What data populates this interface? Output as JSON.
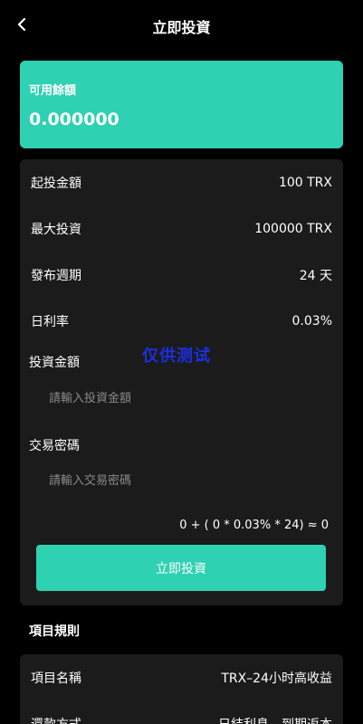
{
  "header": {
    "title": "立即投資",
    "back_icon": "chevron-left-icon"
  },
  "balance": {
    "label": "可用餘額",
    "value": "0.000000",
    "color": "#2ed1b1"
  },
  "info": {
    "min_invest": {
      "label": "起投金額",
      "value": "100 TRX"
    },
    "max_invest": {
      "label": "最大投資",
      "value": "100000 TRX"
    },
    "period": {
      "label": "發布週期",
      "value": "24 天"
    },
    "daily_rate": {
      "label": "日利率",
      "value": "0.03%"
    }
  },
  "watermark": "仅供测试",
  "form": {
    "amount_label": "投資金額",
    "amount_placeholder": "請輸入投資金額",
    "password_label": "交易密碼",
    "password_placeholder": "請輸入交易密碼",
    "formula": "0 + ( 0 * 0.03% * 24) ≈ 0",
    "submit_label": "立即投資"
  },
  "rules": {
    "title": "項目規則",
    "items": [
      {
        "label": "項目名稱",
        "value": "TRX–24小时高收益"
      },
      {
        "label": "還款方式",
        "value": "日結利息，到期返本"
      }
    ]
  }
}
